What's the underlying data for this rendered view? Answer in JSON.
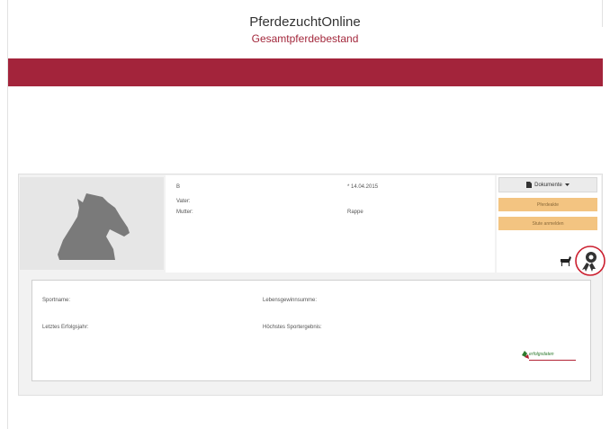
{
  "header": {
    "app_title": "PferdezuchtOnline",
    "subtitle": "Gesamtpferdebestand"
  },
  "horse": {
    "name": "B",
    "father_label": "Vater:",
    "mother_label": "Mutter:",
    "birth": "* 14.04.2015",
    "color": "Rappe"
  },
  "sidebar": {
    "documents_label": "Dokumente",
    "button_1": "Pferdeakte",
    "button_2": "Stute anmelden"
  },
  "details": {
    "sport_name_label": "Sportname:",
    "last_success_year_label": "Letztes Erfolgsjahr:",
    "lifetime_earnings_label": "Lebensgewinnsumme:",
    "highest_result_label": "Höchstes Sportergebnis:"
  },
  "logo": {
    "text": "erfolgsdaten"
  },
  "colors": {
    "brand": "#a3243b",
    "button_orange": "#f3c481",
    "highlight_circle": "#cc1f2f"
  },
  "icons": {
    "photo": "horse-head-silhouette",
    "documents": "document-icon",
    "horse_button": "horse-icon",
    "success_button": "rosette-icon"
  }
}
